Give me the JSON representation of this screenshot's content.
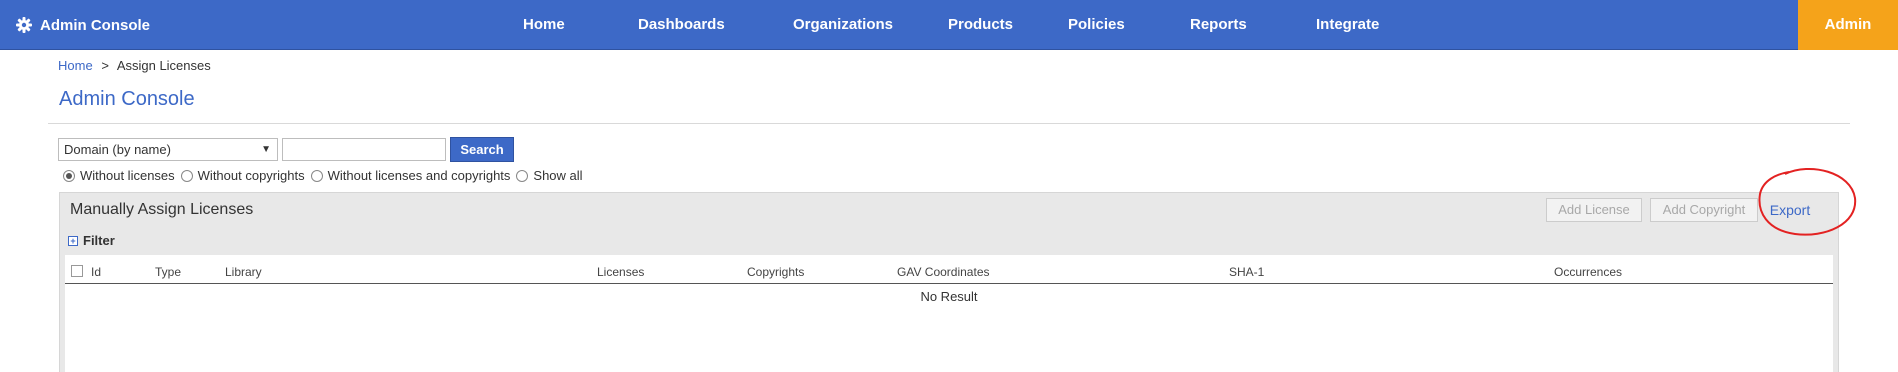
{
  "header": {
    "brand": "Admin Console",
    "nav": [
      "Home",
      "Dashboards",
      "Organizations",
      "Products",
      "Policies",
      "Reports",
      "Integrate"
    ],
    "admin_label": "Admin",
    "bg_color": "#3d69c7",
    "admin_color": "#f5a31a"
  },
  "breadcrumb": {
    "home": "Home",
    "separator": ">",
    "current": "Assign Licenses"
  },
  "page_title": "Admin Console",
  "search": {
    "select_value": "Domain (by name)",
    "input_value": "",
    "button_label": "Search"
  },
  "radio_options": [
    {
      "label": "Without licenses",
      "checked": true
    },
    {
      "label": "Without copyrights",
      "checked": false
    },
    {
      "label": "Without licenses and copyrights",
      "checked": false
    },
    {
      "label": "Show all",
      "checked": false
    }
  ],
  "panel": {
    "title": "Manually Assign Licenses",
    "add_license": "Add License",
    "add_copyright": "Add Copyright",
    "export": "Export",
    "filter_label": "Filter",
    "filter_icon": "+"
  },
  "table": {
    "columns": [
      "Id",
      "Type",
      "Library",
      "Licenses",
      "Copyrights",
      "GAV Coordinates",
      "SHA-1",
      "Occurrences"
    ],
    "empty_text": "No Result"
  }
}
